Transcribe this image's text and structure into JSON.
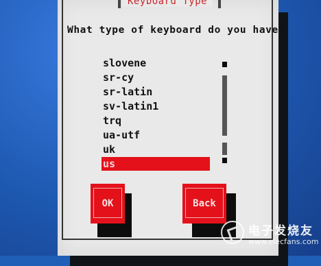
{
  "dialog": {
    "title": "Keyboard Type",
    "prompt": "What type of keyboard do you have?"
  },
  "keyboard_list": {
    "items": [
      "slovene",
      "sr-cy",
      "sr-latin",
      "sv-latin1",
      "trq",
      "ua-utf",
      "uk",
      "us"
    ],
    "selected_index": 7,
    "selected_value": "us"
  },
  "buttons": {
    "ok_label": "OK",
    "back_label": "Back"
  },
  "watermark": {
    "logo_text": "电子发烧友",
    "url": "www.elecfans.com"
  },
  "colors": {
    "desktop_background": "#1f5fb8",
    "dialog_background": "#e9e9e9",
    "accent_red": "#e4111a",
    "title_red": "#c9262a"
  },
  "icons": {
    "watermark_logo": "elecfans-logo-icon"
  }
}
